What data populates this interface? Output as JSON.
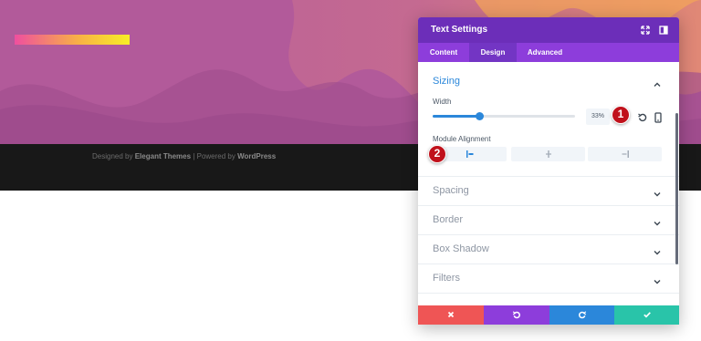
{
  "footer": {
    "designed_by": "Designed by",
    "theme": "Elegant Themes",
    "separator": "| Powered by",
    "platform": "WordPress"
  },
  "panel": {
    "title": "Text Settings",
    "header_icons": [
      "fullscreen-icon",
      "sidebar-toggle-icon"
    ],
    "tabs": [
      {
        "label": "Content",
        "active": false
      },
      {
        "label": "Design",
        "active": true
      },
      {
        "label": "Advanced",
        "active": false
      }
    ],
    "sizing": {
      "title": "Sizing",
      "expanded": true,
      "width_label": "Width",
      "width_value": "33%",
      "width_fraction": 0.33,
      "alignment_label": "Module Alignment",
      "alignment_options": [
        "left",
        "center",
        "right"
      ],
      "alignment_selected": "left"
    },
    "sections": [
      {
        "title": "Spacing"
      },
      {
        "title": "Border"
      },
      {
        "title": "Box Shadow"
      },
      {
        "title": "Filters"
      }
    ],
    "action_icons": [
      "close-icon",
      "undo-icon",
      "redo-icon",
      "save-check-icon"
    ]
  },
  "callouts": [
    "1",
    "2"
  ],
  "colors": {
    "hero": "#b25a9a",
    "panel_header": "#6c2eb9",
    "tabs": "#8d3ddb",
    "accent_blue": "#2b87da",
    "discard": "#ef5555",
    "undo": "#8d3ddb",
    "redo": "#2b87da",
    "save": "#29c4a9",
    "callout": "#c0111b"
  }
}
